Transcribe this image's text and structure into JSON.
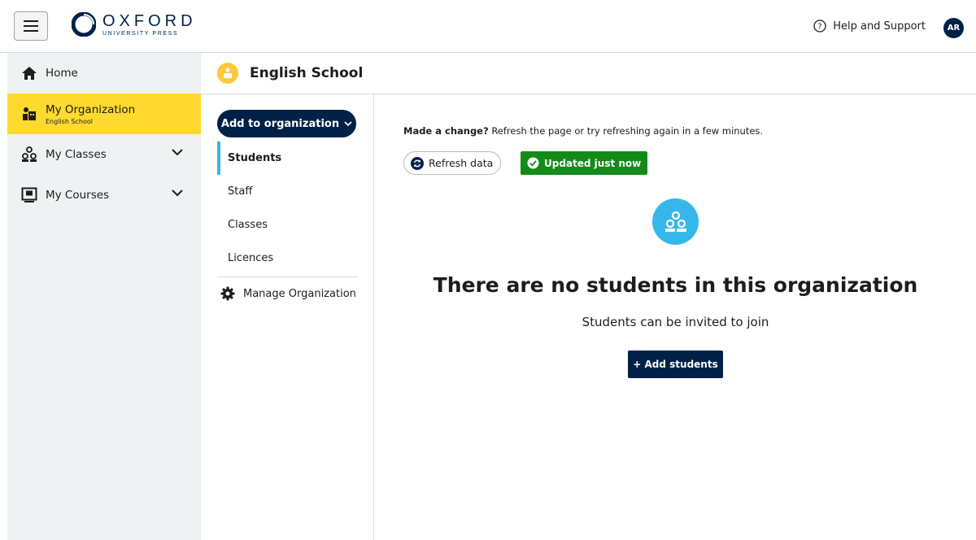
{
  "header": {
    "logo_main": "OXFORD",
    "logo_sub": "UNIVERSITY PRESS",
    "help_label": "Help and Support",
    "avatar_initials": "AR"
  },
  "sidebar": {
    "home_label": "Home",
    "org_label": "My Organization",
    "org_sub": "English School",
    "classes_label": "My Classes",
    "courses_label": "My Courses"
  },
  "org": {
    "title": "English School"
  },
  "subnav": {
    "add_button": "Add to organization",
    "items": [
      "Students",
      "Staff",
      "Classes",
      "Licences"
    ],
    "manage_label": "Manage Organization"
  },
  "main": {
    "notice_bold": "Made a change?",
    "notice_text": "Refresh the page or try refreshing again in a few minutes.",
    "refresh_label": "Refresh data",
    "updated_label": "Updated just now",
    "empty_title": "There are no students in this organization",
    "empty_sub": "Students can be invited to join",
    "add_students_label": "+ Add students"
  },
  "colors": {
    "brand_navy": "#002147",
    "highlight_yellow": "#ffd92e",
    "accent_blue": "#35b7e9",
    "success_green": "#148a1b"
  }
}
